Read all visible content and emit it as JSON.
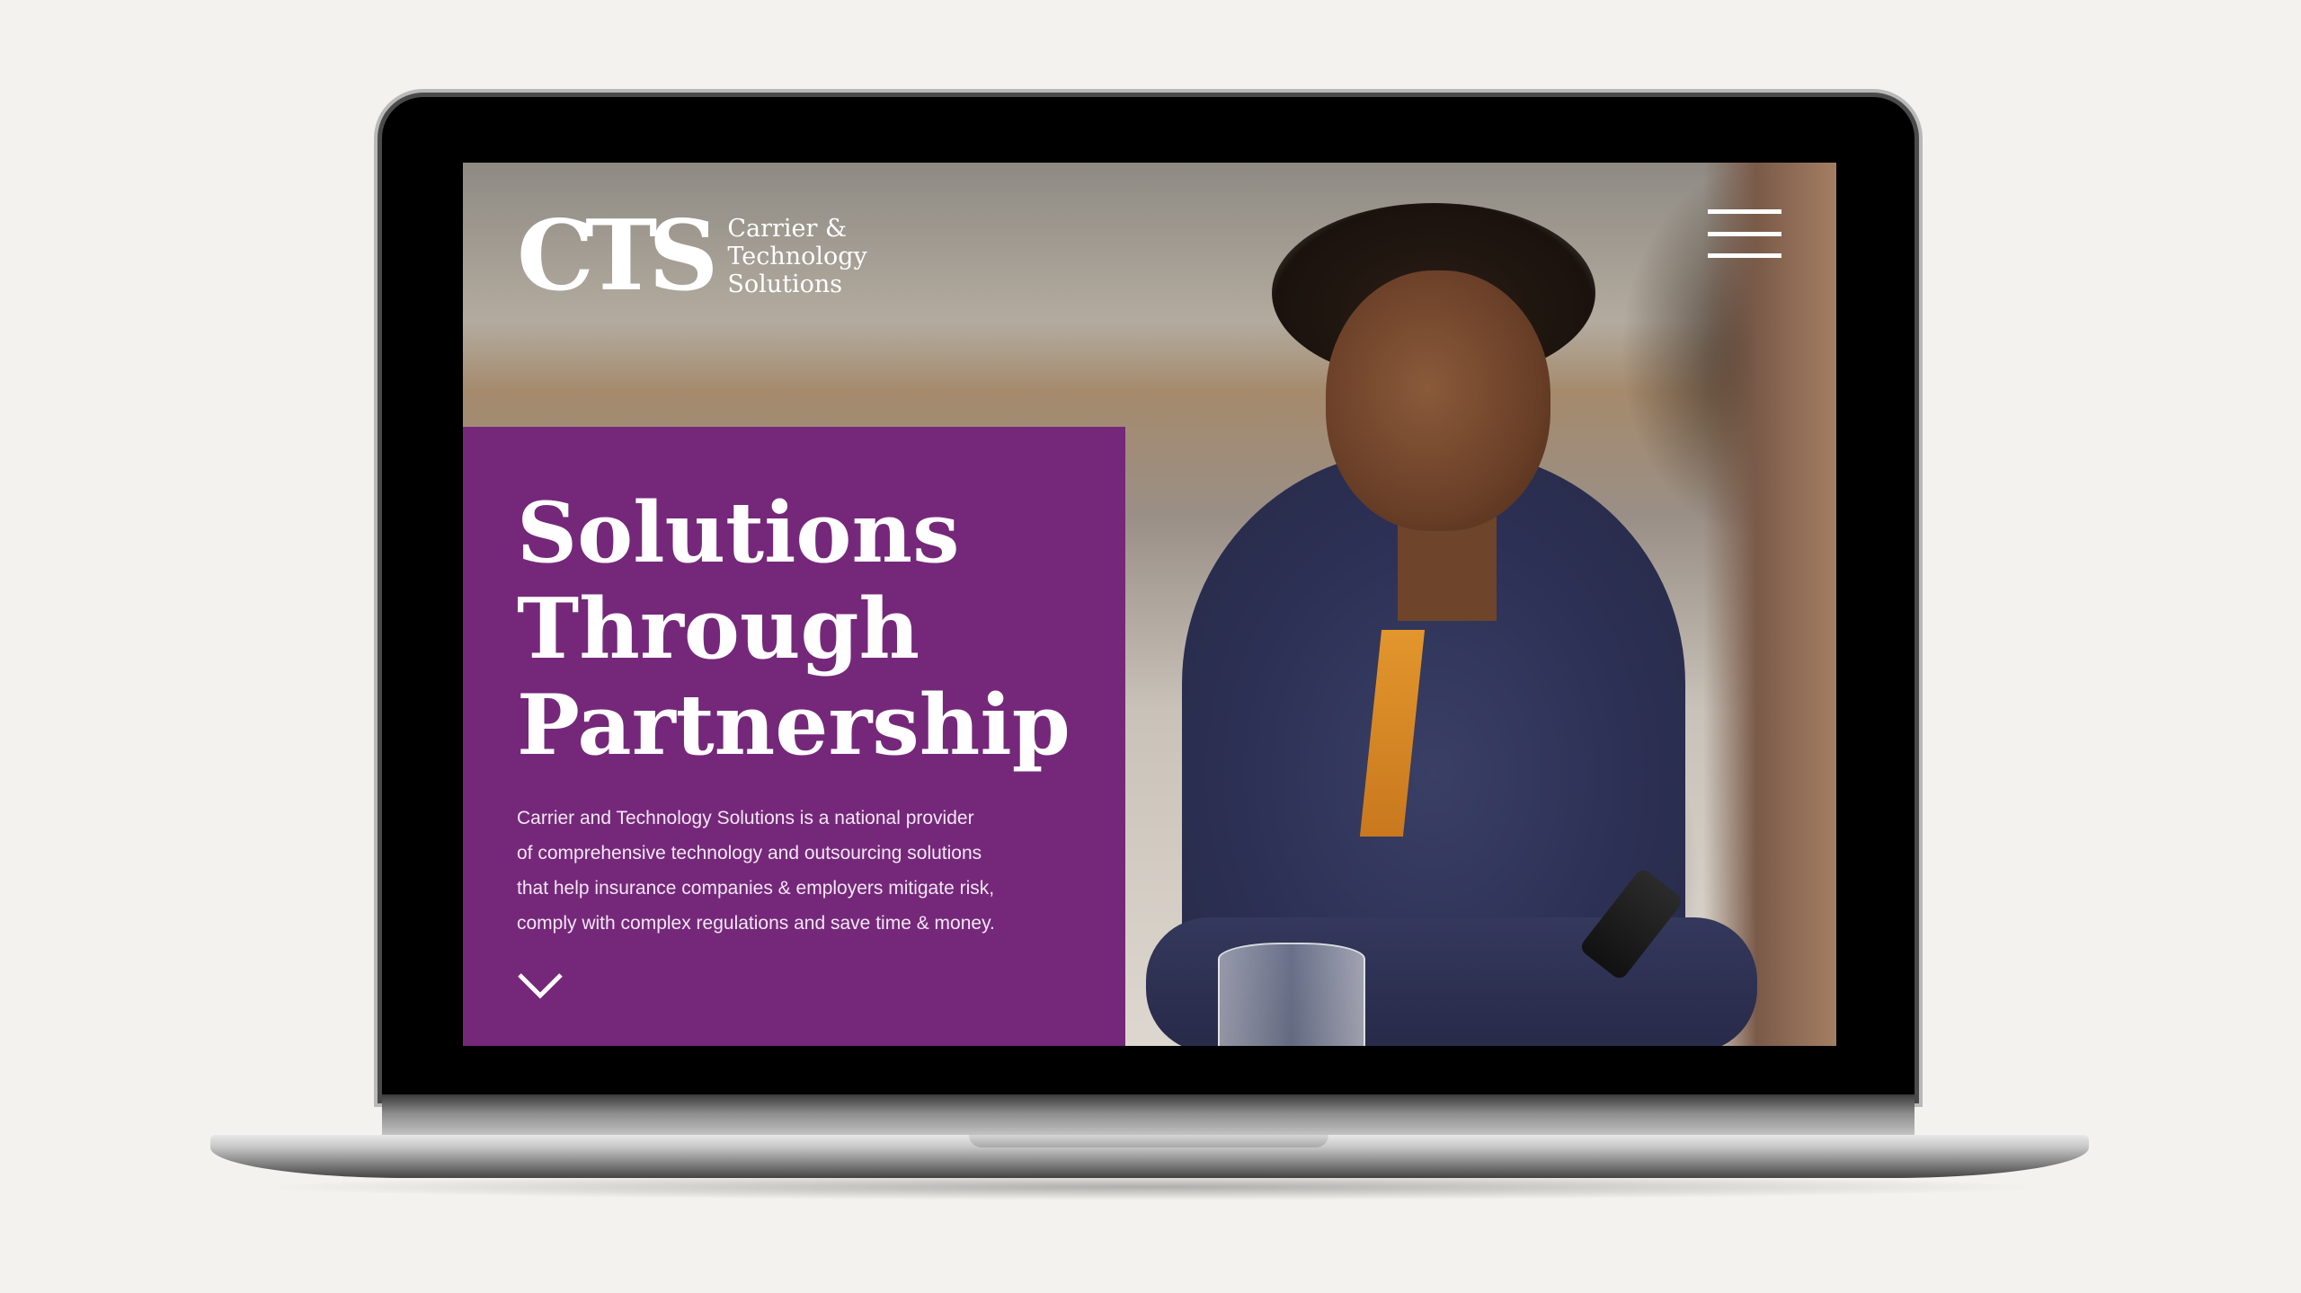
{
  "logo": {
    "mark": "CTS",
    "text_lines": [
      "Carrier &",
      "Technology",
      "Solutions"
    ]
  },
  "hero": {
    "title_lines": [
      "Solutions",
      "Through",
      "Partnership"
    ],
    "description_lines": [
      "Carrier and Technology Solutions is a national provider",
      "of comprehensive technology and outsourcing solutions",
      "that help insurance companies & employers mitigate risk,",
      "comply with complex regulations and save time & money."
    ],
    "scroll_icon": "chevron-down-icon"
  },
  "header": {
    "menu_icon": "hamburger-menu-icon"
  },
  "colors": {
    "brand_purple": "#75287a",
    "text_white": "#ffffff",
    "page_background": "#f3f2ee"
  }
}
